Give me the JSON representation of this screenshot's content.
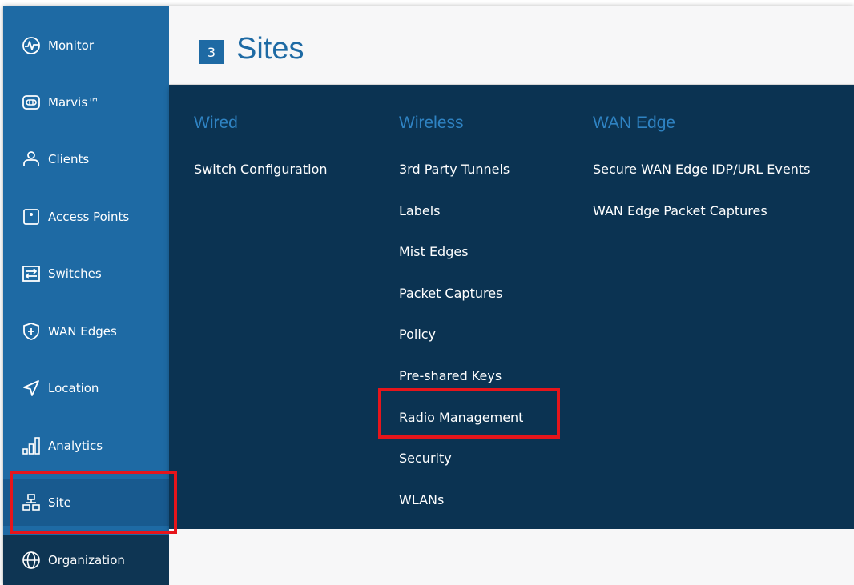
{
  "sidebar": {
    "items": [
      {
        "label": "Monitor",
        "icon": "monitor-icon"
      },
      {
        "label": "Marvis™",
        "icon": "marvis-icon"
      },
      {
        "label": "Clients",
        "icon": "clients-icon"
      },
      {
        "label": "Access Points",
        "icon": "access-point-icon"
      },
      {
        "label": "Switches",
        "icon": "switch-icon"
      },
      {
        "label": "WAN Edges",
        "icon": "wan-edge-icon"
      },
      {
        "label": "Location",
        "icon": "location-icon"
      },
      {
        "label": "Analytics",
        "icon": "analytics-icon"
      },
      {
        "label": "Site",
        "icon": "site-icon"
      },
      {
        "label": "Organization",
        "icon": "organization-icon"
      }
    ]
  },
  "header": {
    "badge": "3",
    "title": "Sites"
  },
  "menu": {
    "wired": {
      "heading": "Wired",
      "items": [
        "Switch Configuration"
      ]
    },
    "wireless": {
      "heading": "Wireless",
      "items": [
        "3rd Party Tunnels",
        "Labels",
        "Mist Edges",
        "Packet Captures",
        "Policy",
        "Pre-shared Keys",
        "Radio Management",
        "Security",
        "WLANs"
      ]
    },
    "wan_edge": {
      "heading": "WAN Edge",
      "items": [
        "Secure WAN Edge IDP/URL Events",
        "WAN Edge Packet Captures"
      ]
    },
    "highlighted_item": "Radio Management"
  },
  "colors": {
    "sidebar": "#1e6aa4",
    "panel": "#0b3352",
    "accent": "#2f83c3",
    "highlight": "#e6151b"
  }
}
